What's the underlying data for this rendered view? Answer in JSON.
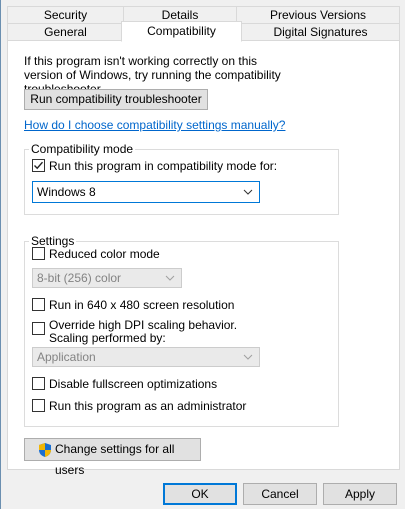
{
  "tabs": {
    "row1": [
      "Security",
      "Details",
      "Previous Versions"
    ],
    "row2": [
      "General",
      "Compatibility",
      "Digital Signatures"
    ]
  },
  "intro": "If this program isn't working correctly on this version of Windows, try running the compatibility troubleshooter.",
  "troubleshooter_button": "Run compatibility troubleshooter",
  "manual_link": "How do I choose compatibility settings manually?",
  "compat_mode": {
    "label": "Compatibility mode",
    "checkbox_label": "Run this program in compatibility mode for:",
    "checked": true,
    "selected": "Windows 8"
  },
  "settings": {
    "label": "Settings",
    "reduced_color": "Reduced color mode",
    "color_select": "8-bit (256) color",
    "res_640": "Run in 640 x 480 screen resolution",
    "dpi_line1": "Override high DPI scaling behavior.",
    "dpi_line2": "Scaling performed by:",
    "dpi_select": "Application",
    "fullscreen": "Disable fullscreen optimizations",
    "admin": "Run this program as an administrator"
  },
  "change_all_button": "Change settings for all users",
  "footer": {
    "ok": "OK",
    "cancel": "Cancel",
    "apply": "Apply"
  },
  "colors": {
    "accent": "#0078d7",
    "link": "#0066cc"
  }
}
